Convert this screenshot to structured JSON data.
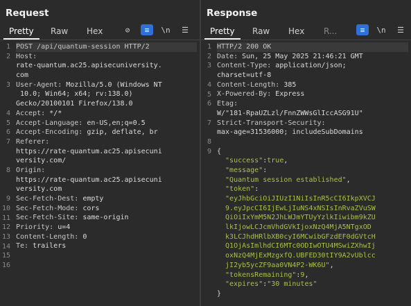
{
  "request": {
    "title": "Request",
    "tabs": [
      "Pretty",
      "Raw",
      "Hex"
    ],
    "line_numbers": [
      "1",
      "2",
      "3",
      "4",
      "5",
      "6",
      "7",
      "8",
      "9",
      "10",
      "11",
      "12",
      "13",
      "14",
      "15",
      "16"
    ],
    "lines": [
      {
        "n": "1",
        "parts": [
          {
            "t": "POST /api/quantum-session HTTP/2",
            "c": "key"
          }
        ],
        "hl": true
      },
      {
        "n": "2",
        "parts": [
          {
            "t": "Host:",
            "c": "key"
          }
        ]
      },
      {
        "n": "",
        "parts": [
          {
            "t": "rate-quantum.ac25.apisecuniversity.",
            "c": ""
          }
        ]
      },
      {
        "n": "",
        "parts": [
          {
            "t": "com",
            "c": ""
          }
        ]
      },
      {
        "n": "3",
        "parts": [
          {
            "t": "User-Agent:",
            "c": "key"
          },
          {
            "t": " Mozilla/5.0 (Windows NT",
            "c": ""
          }
        ]
      },
      {
        "n": "",
        "parts": [
          {
            "t": " 10.0; Win64; x64; rv:138.0)",
            "c": ""
          }
        ]
      },
      {
        "n": "",
        "parts": [
          {
            "t": "Gecko/20100101 Firefox/138.0",
            "c": ""
          }
        ]
      },
      {
        "n": "4",
        "parts": [
          {
            "t": "Accept:",
            "c": "key"
          },
          {
            "t": " */*",
            "c": ""
          }
        ]
      },
      {
        "n": "5",
        "parts": [
          {
            "t": "Accept-Language:",
            "c": "key"
          },
          {
            "t": " en-US,en;q=0.5",
            "c": ""
          }
        ]
      },
      {
        "n": "6",
        "parts": [
          {
            "t": "Accept-Encoding:",
            "c": "key"
          },
          {
            "t": " gzip, deflate, br",
            "c": ""
          }
        ]
      },
      {
        "n": "7",
        "parts": [
          {
            "t": "Referer:",
            "c": "key"
          }
        ]
      },
      {
        "n": "",
        "parts": [
          {
            "t": "https://rate-quantum.ac25.apisecuni",
            "c": ""
          }
        ]
      },
      {
        "n": "",
        "parts": [
          {
            "t": "versity.com/",
            "c": ""
          }
        ]
      },
      {
        "n": "8",
        "parts": [
          {
            "t": "Origin:",
            "c": "key"
          }
        ]
      },
      {
        "n": "",
        "parts": [
          {
            "t": "https://rate-quantum.ac25.apisecuni",
            "c": ""
          }
        ]
      },
      {
        "n": "",
        "parts": [
          {
            "t": "versity.com",
            "c": ""
          }
        ]
      },
      {
        "n": "9",
        "parts": [
          {
            "t": "Sec-Fetch-Dest:",
            "c": "key"
          },
          {
            "t": " empty",
            "c": ""
          }
        ]
      },
      {
        "n": "10",
        "parts": [
          {
            "t": "Sec-Fetch-Mode:",
            "c": "key"
          },
          {
            "t": " cors",
            "c": ""
          }
        ]
      },
      {
        "n": "11",
        "parts": [
          {
            "t": "Sec-Fetch-Site:",
            "c": "key"
          },
          {
            "t": " same-origin",
            "c": ""
          }
        ]
      },
      {
        "n": "12",
        "parts": [
          {
            "t": "Priority:",
            "c": "key"
          },
          {
            "t": " u=4",
            "c": ""
          }
        ]
      },
      {
        "n": "13",
        "parts": [
          {
            "t": "Content-Length:",
            "c": "key"
          },
          {
            "t": " 0",
            "c": ""
          }
        ]
      },
      {
        "n": "14",
        "parts": [
          {
            "t": "Te:",
            "c": "key"
          },
          {
            "t": " trailers",
            "c": ""
          }
        ]
      },
      {
        "n": "15",
        "parts": []
      },
      {
        "n": "16",
        "parts": []
      }
    ],
    "tools": {
      "hide": "⊘",
      "wrap": "≡",
      "newline": "\\n",
      "menu": "☰"
    }
  },
  "response": {
    "title": "Response",
    "tabs": [
      "Pretty",
      "Raw",
      "Hex",
      "R..."
    ],
    "lines": [
      {
        "n": "1",
        "parts": [
          {
            "t": "HTTP/2 200 OK",
            "c": "key"
          }
        ],
        "hl": true
      },
      {
        "n": "2",
        "parts": [
          {
            "t": "Date:",
            "c": "key"
          },
          {
            "t": " Sun, 25 May 2025 21:46:21 GMT",
            "c": ""
          }
        ]
      },
      {
        "n": "3",
        "parts": [
          {
            "t": "Content-Type:",
            "c": "key"
          },
          {
            "t": " application/json;",
            "c": ""
          }
        ]
      },
      {
        "n": "",
        "parts": [
          {
            "t": "charset=utf-8",
            "c": ""
          }
        ]
      },
      {
        "n": "4",
        "parts": [
          {
            "t": "Content-Length:",
            "c": "key"
          },
          {
            "t": " 385",
            "c": ""
          }
        ]
      },
      {
        "n": "5",
        "parts": [
          {
            "t": "X-Powered-By:",
            "c": "key"
          },
          {
            "t": " Express",
            "c": ""
          }
        ]
      },
      {
        "n": "6",
        "parts": [
          {
            "t": "Etag:",
            "c": "key"
          }
        ]
      },
      {
        "n": "",
        "parts": [
          {
            "t": "W/\"181-RpaUZLzl/FnnZWWsGlIccASG91U\"",
            "c": ""
          }
        ]
      },
      {
        "n": "7",
        "parts": [
          {
            "t": "Strict-Transport-Security:",
            "c": "key"
          }
        ]
      },
      {
        "n": "",
        "parts": [
          {
            "t": "max-age=31536000; includeSubDomains",
            "c": ""
          }
        ]
      },
      {
        "n": "8",
        "parts": []
      },
      {
        "n": "9",
        "parts": [
          {
            "t": "{",
            "c": "punc"
          }
        ]
      },
      {
        "n": "",
        "parts": [
          {
            "t": "  \"success\"",
            "c": "jkey"
          },
          {
            "t": ":",
            "c": "punc"
          },
          {
            "t": "true",
            "c": "jbool"
          },
          {
            "t": ",",
            "c": "punc"
          }
        ]
      },
      {
        "n": "",
        "parts": [
          {
            "t": "  \"message\"",
            "c": "jkey"
          },
          {
            "t": ":",
            "c": "punc"
          }
        ]
      },
      {
        "n": "",
        "parts": [
          {
            "t": "  \"Quantum session established\"",
            "c": "jstr"
          },
          {
            "t": ",",
            "c": "punc"
          }
        ]
      },
      {
        "n": "",
        "parts": [
          {
            "t": "  \"token\"",
            "c": "jkey"
          },
          {
            "t": ":",
            "c": "punc"
          }
        ]
      },
      {
        "n": "",
        "parts": [
          {
            "t": "  \"eyJhbGciOiJIUzI1NiIsInR5cCI6IkpXVCJ",
            "c": "jstr"
          }
        ]
      },
      {
        "n": "",
        "parts": [
          {
            "t": "  9.eyJpcCI6IjEwLjIuNS4xNSIsInRvaZVuSW",
            "c": "jstr"
          }
        ]
      },
      {
        "n": "",
        "parts": [
          {
            "t": "  QiOiIxYmM5N2JhLWJmYTUyYzlkIiwibm9kZU",
            "c": "jstr"
          }
        ]
      },
      {
        "n": "",
        "parts": [
          {
            "t": "  lkIjowLCJcmVhdGVkIjoxNzQ4MjA5NTgxOD",
            "c": "jstr"
          }
        ]
      },
      {
        "n": "",
        "parts": [
          {
            "t": "  k3LCJhdHRlbXB0cyI6MCwibGFzdEF0dGVtcH",
            "c": "jstr"
          }
        ]
      },
      {
        "n": "",
        "parts": [
          {
            "t": "  Q1OjAsImlhdCI6MTc0ODIwOTU4MSwiZXhwIj",
            "c": "jstr"
          }
        ]
      },
      {
        "n": "",
        "parts": [
          {
            "t": "  oxNzQ4MjExMzgxfQ.UBFED30tIY9A2vUblcc",
            "c": "jstr"
          }
        ]
      },
      {
        "n": "",
        "parts": [
          {
            "t": "  jI2yb5ycZF9aa0VN4P2-WK6U\"",
            "c": "jstr"
          },
          {
            "t": ",",
            "c": "punc"
          }
        ]
      },
      {
        "n": "",
        "parts": [
          {
            "t": "  \"tokensRemaining\"",
            "c": "jkey"
          },
          {
            "t": ":",
            "c": "punc"
          },
          {
            "t": "9",
            "c": "jbool"
          },
          {
            "t": ",",
            "c": "punc"
          }
        ]
      },
      {
        "n": "",
        "parts": [
          {
            "t": "  \"expires\"",
            "c": "jkey"
          },
          {
            "t": ":",
            "c": "punc"
          },
          {
            "t": "\"30 minutes\"",
            "c": "jstr"
          }
        ]
      },
      {
        "n": "",
        "parts": [
          {
            "t": "}",
            "c": "punc"
          }
        ]
      }
    ],
    "line_number_map": [
      {
        "n": "1",
        "row": 0
      },
      {
        "n": "2",
        "row": 1
      },
      {
        "n": "3",
        "row": 2
      },
      {
        "n": "4",
        "row": 4
      },
      {
        "n": "5",
        "row": 5
      },
      {
        "n": "6",
        "row": 6
      },
      {
        "n": "7",
        "row": 8
      },
      {
        "n": "8",
        "row": 10
      },
      {
        "n": "9",
        "row": 11
      }
    ],
    "tools": {
      "wrap": "≡",
      "newline": "\\n",
      "menu": "☰"
    }
  },
  "colors": {
    "accent": "#2f6fd6",
    "json": "#a9c04f"
  }
}
